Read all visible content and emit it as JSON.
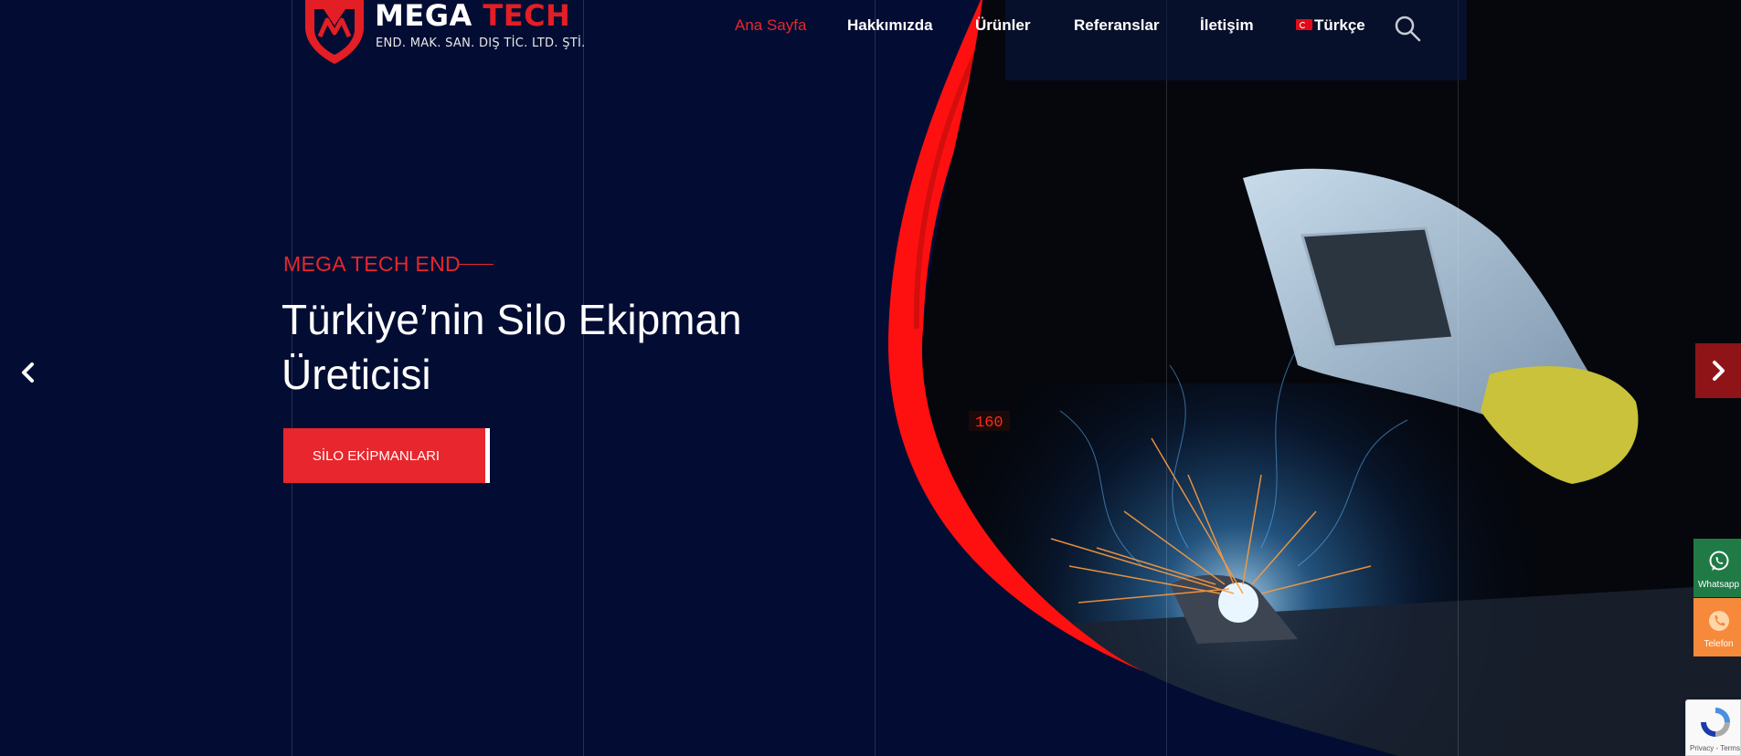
{
  "brand": {
    "name_white": "MEGA",
    "name_red": "TECH",
    "subtitle": "END. MAK. SAN. DIŞ TİC. LTD. ŞTİ."
  },
  "nav": {
    "items": [
      {
        "label": "Ana Sayfa",
        "active": true
      },
      {
        "label": "Hakkımızda",
        "active": false
      },
      {
        "label": "Ürünler",
        "active": false
      },
      {
        "label": "Referanslar",
        "active": false
      },
      {
        "label": "İletişim",
        "active": false
      }
    ],
    "language": "Türkçe",
    "search_icon": "search-icon"
  },
  "hero": {
    "kicker": "MEGA TECH END",
    "title": "Türkiye’nin Silo Ekipman Üreticisi",
    "button_label": "SİLO EKİPMANLARI",
    "photo_display": "160"
  },
  "slider": {
    "prev_icon": "chevron-left-icon",
    "next_icon": "chevron-right-icon"
  },
  "floating_contact": {
    "whatsapp_label": "Whatsapp",
    "phone_label": "Telefon"
  },
  "recaptcha": {
    "text": "Privacy - Terms"
  },
  "colors": {
    "background": "#030d33",
    "accent_red": "#e8262d",
    "dark_red": "#8f1418",
    "whatsapp_green": "#1f7a45",
    "phone_orange": "#f68a3a"
  }
}
